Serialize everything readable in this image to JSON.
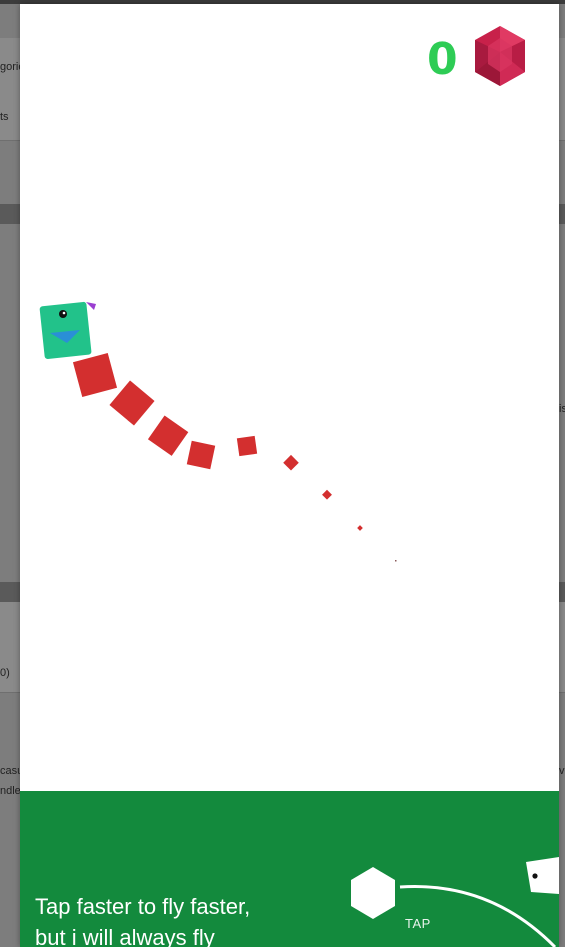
{
  "background_page": {
    "fragments": [
      "gorie",
      "ts",
      "",
      "is",
      "0)",
      "casu",
      "ndle",
      "ve"
    ]
  },
  "game": {
    "score": "0",
    "currency_icon": "red-gem-icon",
    "character": "green-square-bird",
    "trail_color": "#d32f2f",
    "accent_color": "#2ecc55",
    "banner_color": "#138a3d"
  },
  "tutorial": {
    "tip_line1": "Tap faster to fly faster,",
    "tip_line2": "but i will always fly",
    "tap_label": "TAP"
  }
}
